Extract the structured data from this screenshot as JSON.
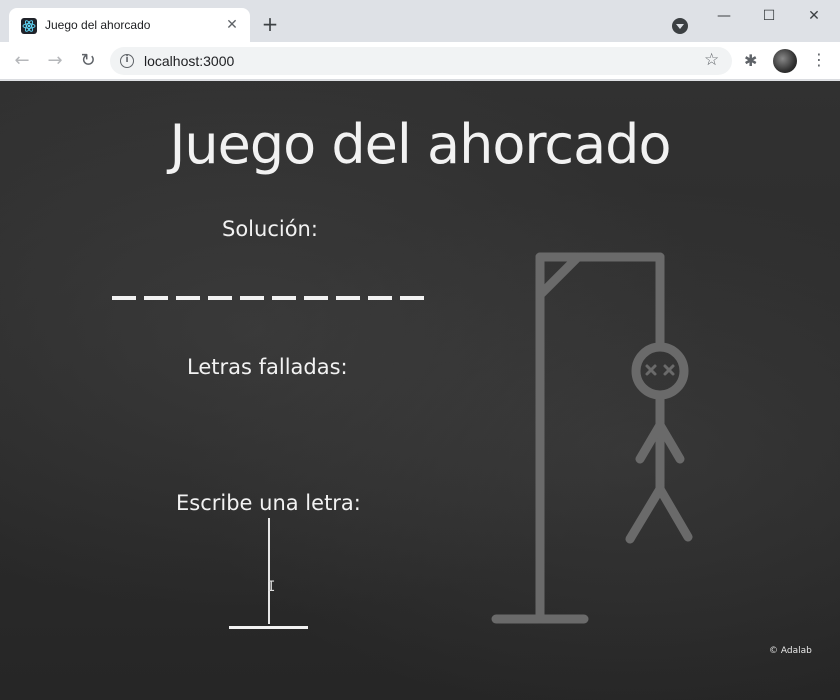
{
  "browser": {
    "tab_title": "Juego del ahorcado",
    "tab_close": "✕",
    "new_tab": "+",
    "url": "localhost:3000",
    "window_controls": {
      "minimize": "—",
      "maximize": "☐",
      "close": "✕"
    },
    "nav": {
      "back": "←",
      "forward": "→",
      "reload": "↻"
    },
    "icons": {
      "favicon": "react-atom-icon",
      "info": "info-icon",
      "star": "star-icon",
      "extensions": "puzzle-icon",
      "menu": "kebab-menu-icon"
    }
  },
  "game": {
    "title": "Juego del ahorcado",
    "solution_label": "Solución:",
    "solution_blanks": [
      "_",
      "_",
      "_",
      "_",
      "_",
      "_",
      "_",
      "_",
      "_",
      "_"
    ],
    "missed_label": "Letras falladas:",
    "missed_letters": "",
    "input_label": "Escribe una letra:",
    "input_value": "",
    "copyright": "© Adalab",
    "hangman_parts_shown": 6,
    "chalk_color": "#f2f2f2",
    "gallows_color": "#6a6a6a"
  }
}
